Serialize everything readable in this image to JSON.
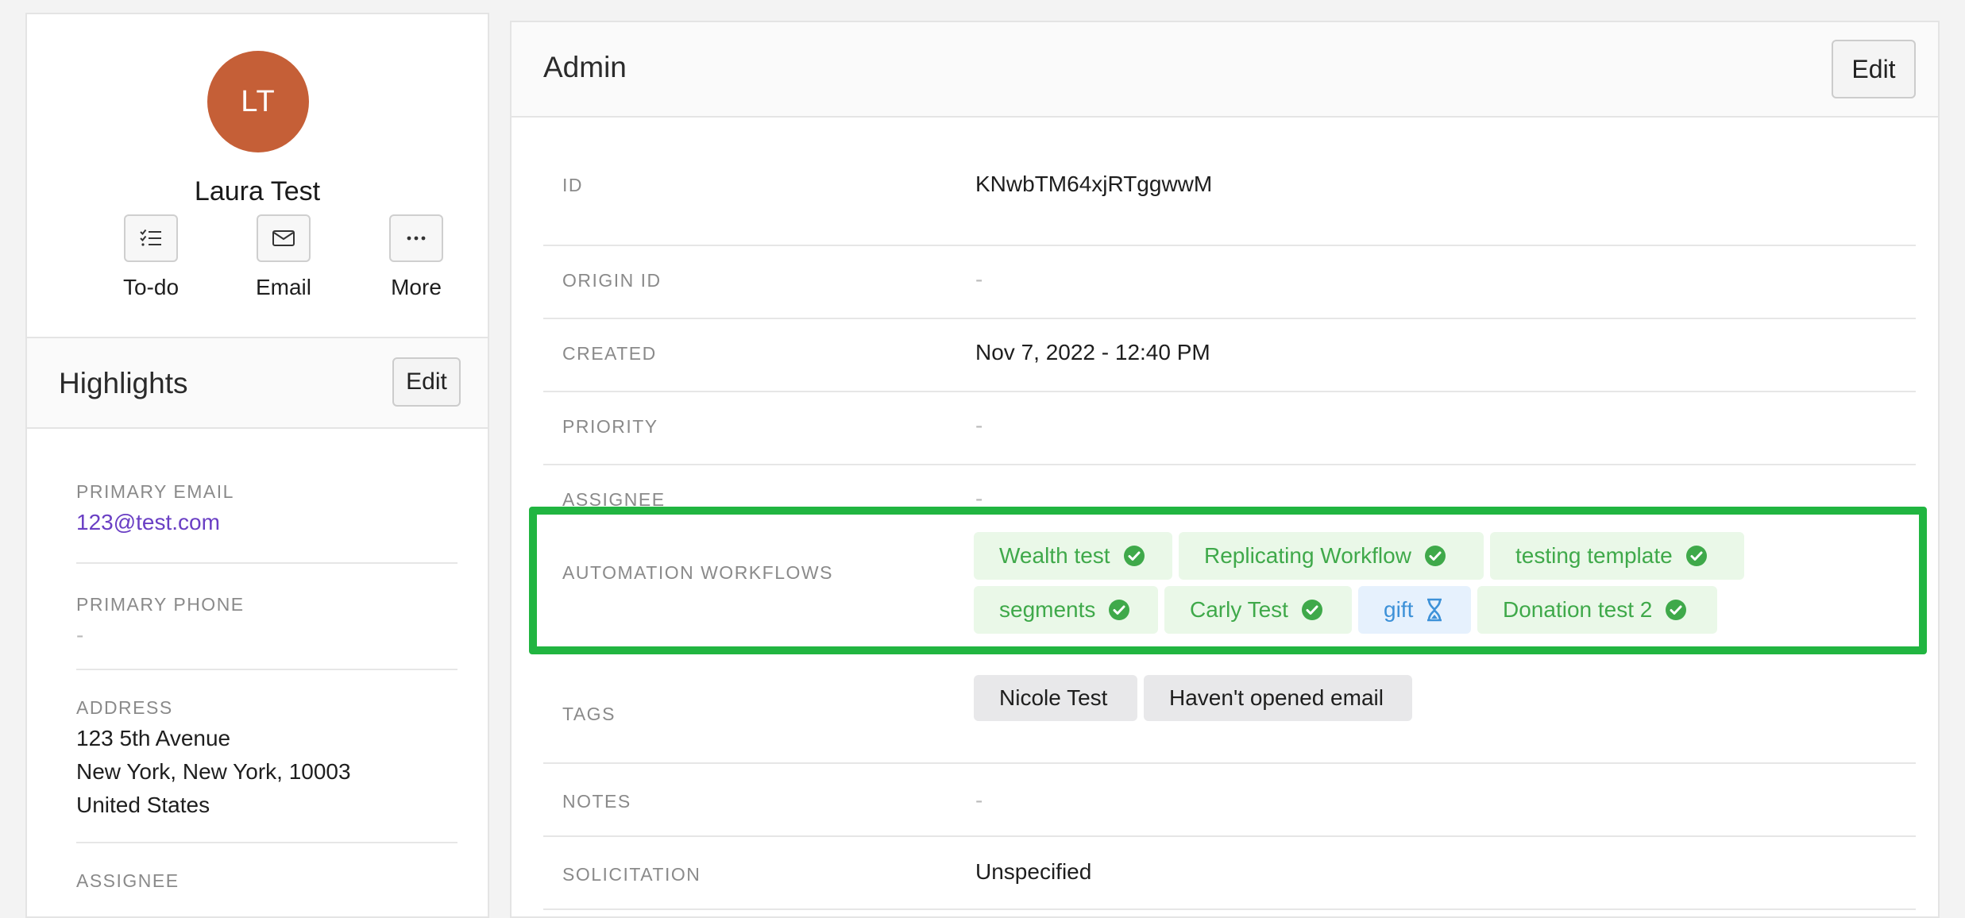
{
  "profile": {
    "initials": "LT",
    "name": "Laura Test",
    "actions": [
      {
        "label": "To-do",
        "icon": "checklist-icon"
      },
      {
        "label": "Email",
        "icon": "envelope-icon"
      },
      {
        "label": "More",
        "icon": "ellipsis-icon"
      }
    ]
  },
  "highlights": {
    "title": "Highlights",
    "edit_label": "Edit",
    "items": [
      {
        "label": "PRIMARY EMAIL",
        "value": "123@test.com"
      },
      {
        "label": "PRIMARY PHONE",
        "value": "-"
      },
      {
        "label": "ADDRESS",
        "lines": [
          "123 5th Avenue",
          "New York, New York, 10003",
          "United States"
        ]
      },
      {
        "label": "ASSIGNEE",
        "value": ""
      }
    ]
  },
  "admin": {
    "title": "Admin",
    "edit_label": "Edit",
    "fields": [
      {
        "label": "ID",
        "value": "KNwbTM64xjRTggwwM"
      },
      {
        "label": "ORIGIN ID",
        "value": "-"
      },
      {
        "label": "CREATED",
        "value": "Nov 7, 2022 - 12:40 PM"
      },
      {
        "label": "PRIORITY",
        "value": "-"
      },
      {
        "label": "ASSIGNEE",
        "value": "-"
      },
      {
        "label": "AUTOMATION WORKFLOWS",
        "value": ""
      },
      {
        "label": "TAGS",
        "value": ""
      },
      {
        "label": "NOTES",
        "value": "-"
      },
      {
        "label": "SOLICITATION",
        "value": "Unspecified"
      }
    ],
    "workflows": [
      {
        "name": "Wealth test",
        "status": "complete"
      },
      {
        "name": "Replicating Workflow",
        "status": "complete"
      },
      {
        "name": "testing template",
        "status": "complete"
      },
      {
        "name": "segments",
        "status": "complete"
      },
      {
        "name": "Carly Test",
        "status": "complete"
      },
      {
        "name": "gift",
        "status": "pending"
      },
      {
        "name": "Donation test 2",
        "status": "complete"
      }
    ],
    "tags": [
      "Nicole Test",
      "Haven't opened email"
    ]
  },
  "colors": {
    "avatar": "#c55f37",
    "link": "#6a3fc4",
    "workflow_complete": "#3fa94a",
    "workflow_pending": "#3d91d8",
    "highlight_border": "#21b541"
  }
}
